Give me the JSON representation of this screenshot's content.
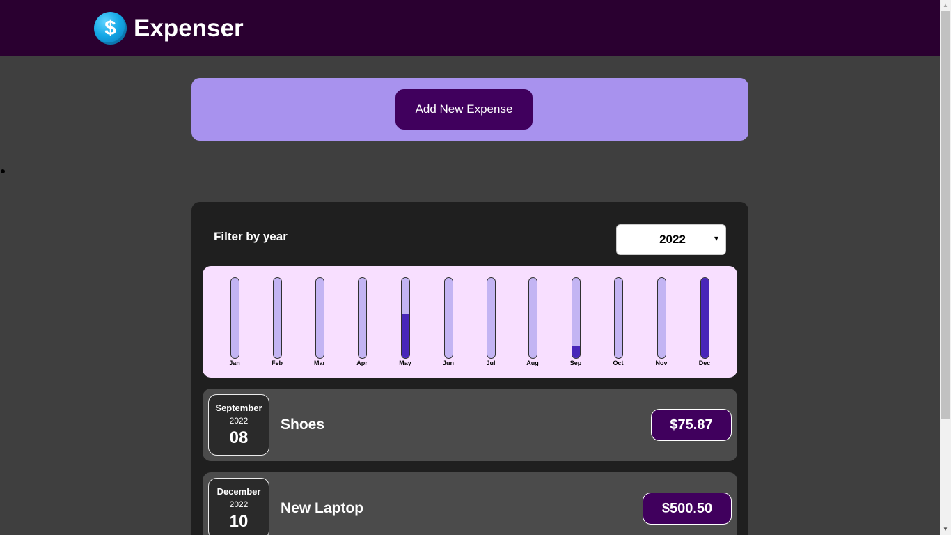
{
  "header": {
    "app_title": "Expenser",
    "logo_icon": "dollar-coin-icon",
    "logo_glyph": "$"
  },
  "new_expense": {
    "add_button_label": "Add New Expense"
  },
  "filter": {
    "label": "Filter by year",
    "selected_year": "2022",
    "arrow_glyph": "▾"
  },
  "chart_data": {
    "type": "bar",
    "categories": [
      "Jan",
      "Feb",
      "Mar",
      "Apr",
      "May",
      "Jun",
      "Jul",
      "Aug",
      "Sep",
      "Oct",
      "Nov",
      "Dec"
    ],
    "values": [
      0,
      0,
      0,
      0,
      0.55,
      0,
      0,
      0,
      0.15,
      0,
      0,
      1.0
    ],
    "ylim": [
      0,
      1
    ],
    "colors": {
      "fill": "#4826b9",
      "track": "#c3b4f3",
      "background": "#f8dfff"
    }
  },
  "expenses": [
    {
      "month": "September",
      "year": "2022",
      "day": "08",
      "title": "Shoes",
      "amount": "$75.87"
    },
    {
      "month": "December",
      "year": "2022",
      "day": "10",
      "title": "New Laptop",
      "amount": "$500.50"
    }
  ],
  "scrollbar": {
    "up_glyph": "▲",
    "down_glyph": "▼"
  }
}
